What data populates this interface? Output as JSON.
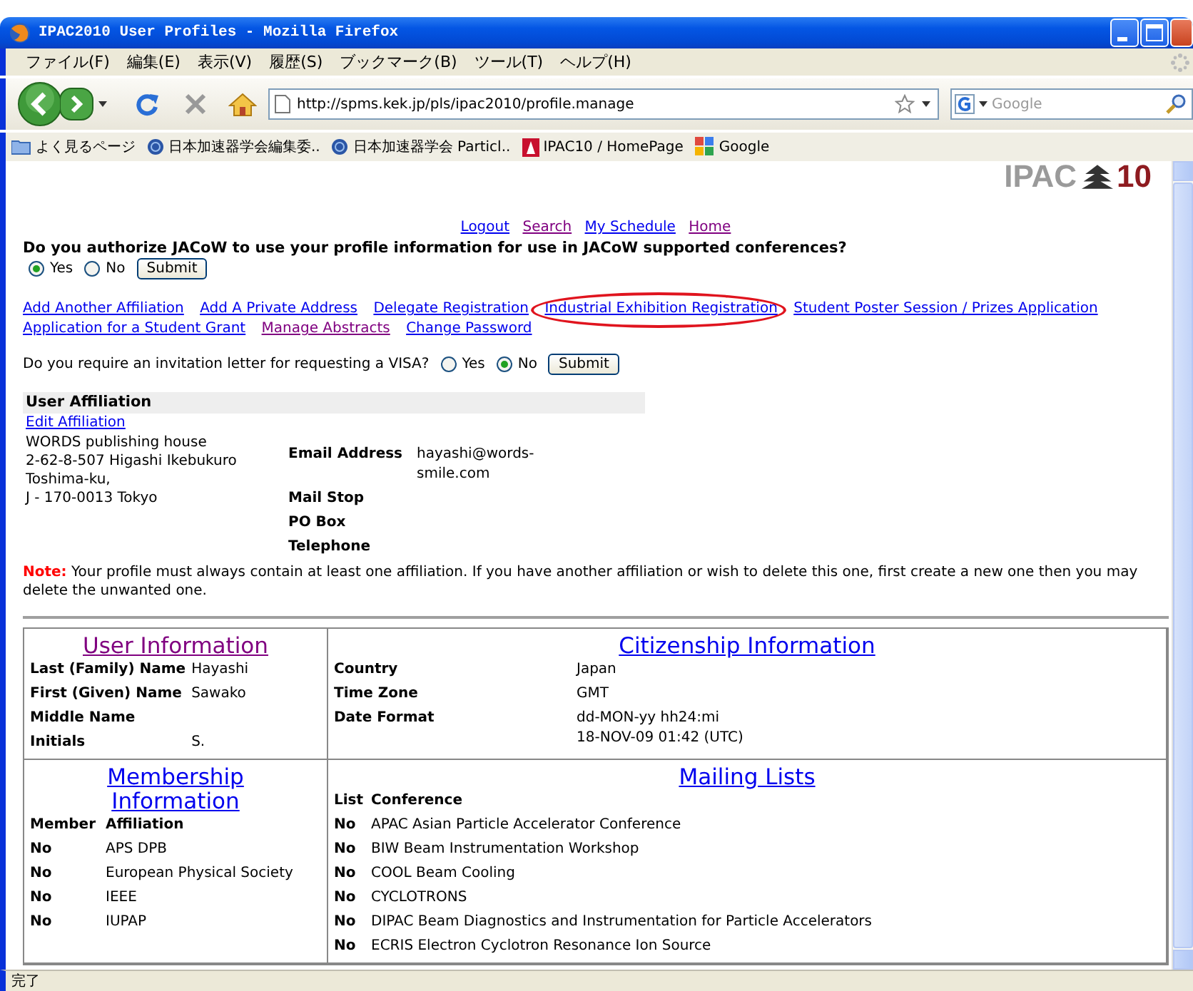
{
  "window": {
    "title": "IPAC2010 User Profiles - Mozilla Firefox"
  },
  "menu": [
    "ファイル(F)",
    "編集(E)",
    "表示(V)",
    "履歴(S)",
    "ブックマーク(B)",
    "ツール(T)",
    "ヘルプ(H)"
  ],
  "address": {
    "value": "http://spms.kek.jp/pls/ipac2010/profile.manage"
  },
  "search": {
    "placeholder": "Google"
  },
  "bookmarks": [
    {
      "label": "よく見るページ",
      "kind": "folder"
    },
    {
      "label": "日本加速器学会編集委..",
      "kind": "site"
    },
    {
      "label": "日本加速器学会 Particl..",
      "kind": "site"
    },
    {
      "label": "IPAC10 / HomePage",
      "kind": "ipac"
    },
    {
      "label": "Google",
      "kind": "google"
    }
  ],
  "logo": {
    "name": "IPAC",
    "number": "10"
  },
  "top_links": [
    {
      "label": "Logout",
      "visited": false
    },
    {
      "label": "Search",
      "visited": true
    },
    {
      "label": "My Schedule",
      "visited": false
    },
    {
      "label": "Home",
      "visited": true
    }
  ],
  "consent": {
    "question": "Do you authorize JACoW to use your profile information for use in JACoW supported conferences?",
    "options": [
      {
        "label": "Yes",
        "selected": true
      },
      {
        "label": "No",
        "selected": false
      }
    ],
    "button": "Submit"
  },
  "action_links": [
    {
      "label": "Add Another Affiliation",
      "visited": false,
      "circled": false
    },
    {
      "label": "Add A Private Address",
      "visited": false,
      "circled": false
    },
    {
      "label": "Delegate Registration",
      "visited": false,
      "circled": false
    },
    {
      "label": "Industrial Exhibition Registration",
      "visited": false,
      "circled": true
    },
    {
      "label": "Student Poster Session / Prizes Application",
      "visited": false,
      "circled": false
    },
    {
      "label": "Application for a Student Grant",
      "visited": false,
      "circled": false
    },
    {
      "label": "Manage Abstracts",
      "visited": true,
      "circled": false
    },
    {
      "label": "Change Password",
      "visited": false,
      "circled": false
    }
  ],
  "visa": {
    "question": "Do you require an invitation letter for requesting a VISA?",
    "options": [
      {
        "label": "Yes",
        "selected": false
      },
      {
        "label": "No",
        "selected": true
      }
    ],
    "button": "Submit"
  },
  "affiliation": {
    "heading": "User Affiliation",
    "edit_link": "Edit Affiliation",
    "address": [
      "WORDS publishing house",
      "2-62-8-507 Higashi Ikebukuro",
      "Toshima-ku,",
      "J - 170-0013 Tokyo"
    ],
    "fields": [
      {
        "label": "Email Address",
        "value": "hayashi@words-smile.com"
      },
      {
        "label": "Mail Stop"
      },
      {
        "label": "PO Box"
      },
      {
        "label": "Telephone"
      }
    ]
  },
  "note": "**Note:** Your profile must always contain at least one affiliation. If you have another affiliation or wish to delete this one, first create a new one then you may delete the unwanted one.",
  "user_info": {
    "heading": "User Information",
    "visited": true,
    "fields": [
      {
        "label": "Last (Family) Name",
        "value": "Hayashi"
      },
      {
        "label": "First (Given) Name",
        "value": "Sawako"
      },
      {
        "label": "Middle Name"
      },
      {
        "label": "Initials",
        "value": "S."
      }
    ]
  },
  "citizenship": {
    "heading": "Citizenship Information",
    "visited": false,
    "fields": [
      {
        "label": "Country",
        "value": "Japan"
      },
      {
        "label": "Time Zone",
        "value": "GMT"
      },
      {
        "label": "Date Format",
        "value": "dd-MON-yy hh24:mi",
        "example": "18-NOV-09 01:42 (UTC)"
      }
    ]
  },
  "membership": {
    "heading": "Membership Information",
    "visited": false,
    "columns": [
      "Member",
      "Affiliation"
    ],
    "rows": [
      {
        "member": "No",
        "affiliation": "APS DPB"
      },
      {
        "member": "No",
        "affiliation": "European Physical Society"
      },
      {
        "member": "No",
        "affiliation": "IEEE"
      },
      {
        "member": "No",
        "affiliation": "IUPAP"
      }
    ]
  },
  "mailing_lists": {
    "heading": "Mailing Lists",
    "visited": false,
    "columns": [
      "List",
      "Conference"
    ],
    "rows": [
      {
        "list": "No",
        "conference": "APAC Asian Particle Accelerator Conference"
      },
      {
        "list": "No",
        "conference": "BIW Beam Instrumentation Workshop"
      },
      {
        "list": "No",
        "conference": "COOL Beam Cooling"
      },
      {
        "list": "No",
        "conference": "CYCLOTRONS"
      },
      {
        "list": "No",
        "conference": "DIPAC Beam Diagnostics and Instrumentation for Particle Accelerators"
      },
      {
        "list": "No",
        "conference": "ECRIS Electron Cyclotron Resonance Ion Source"
      }
    ]
  },
  "status_bar": {
    "text": "完了"
  }
}
